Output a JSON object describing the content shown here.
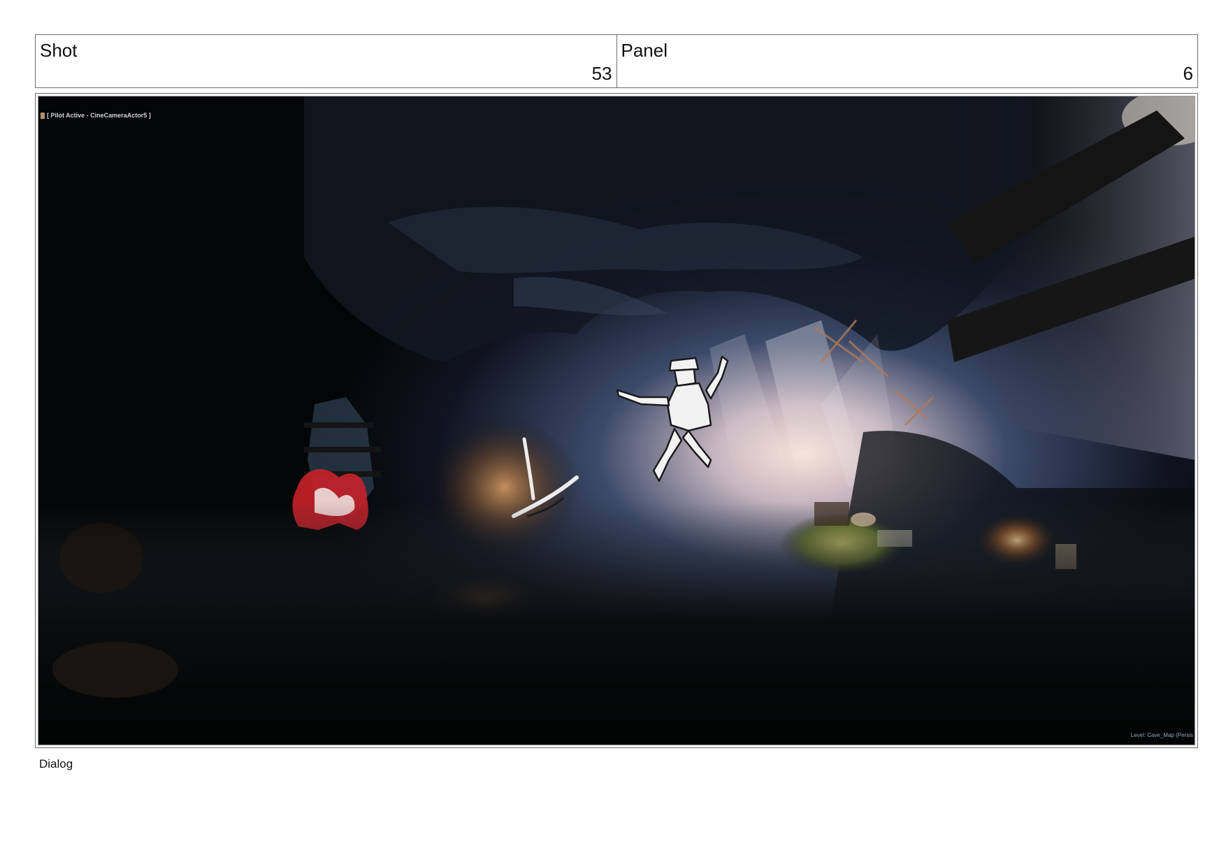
{
  "header": {
    "shot_label": "Shot",
    "shot_number": "53",
    "panel_label": "Panel",
    "panel_number": "6"
  },
  "viewport": {
    "camera_overlay": "[ Pilot Active - CineCameraActor5 ]",
    "level_overlay": "Level:  Cave_Map (Persis"
  },
  "footer": {
    "dialog_label": "Dialog"
  },
  "colors": {
    "border": "#6e6e6e",
    "cave_dark": "#040506",
    "light_glow": "#f3ddd3",
    "sketch_red": "#c8222a"
  }
}
